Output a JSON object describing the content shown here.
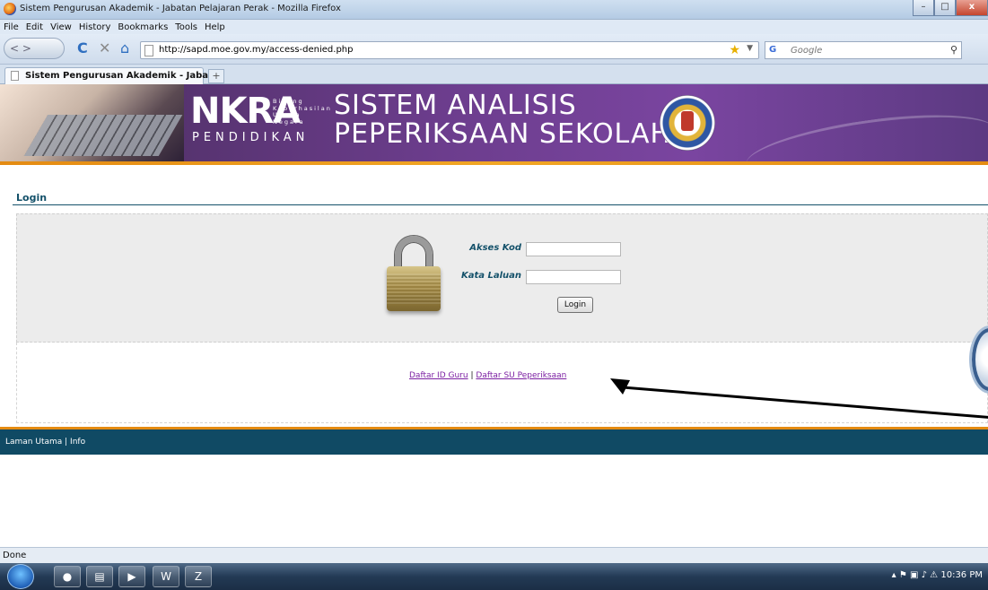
{
  "window": {
    "title": "Sistem Pengurusan Akademik - Jabatan Pelajaran Perak - Mozilla Firefox",
    "controls": {
      "minimize": "–",
      "maximize": "□",
      "close": "x"
    }
  },
  "menu": [
    "File",
    "Edit",
    "View",
    "History",
    "Bookmarks",
    "Tools",
    "Help"
  ],
  "nav": {
    "back_forward": "<  >",
    "reload": "C",
    "stop": "✕",
    "home": "⌂",
    "url": "http://sapd.moe.gov.my/access-denied.php",
    "search_engine": "G",
    "search_placeholder": "Google"
  },
  "tabs": [
    {
      "label": "Sistem Pengurusan Akademik - Jabat..."
    }
  ],
  "new_tab": "+",
  "banner": {
    "nkra": "NKRA",
    "nkra_sub": [
      "Bidang",
      "Keberhasilan",
      "Utama",
      "Negara"
    ],
    "pendidikan": "PENDIDIKAN",
    "line1": "SISTEM ANALISIS",
    "line2": "PEPERIKSAAN SEKOLAH"
  },
  "login": {
    "heading": "Login",
    "access_code_label": "Akses Kod",
    "access_code_value": "",
    "password_label": "Kata Laluan",
    "password_value": "",
    "button": "Login"
  },
  "links": {
    "register_teacher": "Daftar ID Guru",
    "separator": "|",
    "register_exam_sec": "Daftar SU Peperiksaan"
  },
  "footer": {
    "text": "Laman Utama | Info"
  },
  "status": {
    "text": "Done"
  },
  "taskbar": {
    "time": "10:36 PM"
  },
  "colors": {
    "accent": "#14516a",
    "footer": "#104a64",
    "orange": "#e48b12",
    "banner": "#6c3d8d",
    "link": "#7b1fa2"
  },
  "icons": [
    "firefox-icon",
    "lock-icon",
    "emblem-icon",
    "star-icon",
    "search-icon",
    "windows-start-icon"
  ]
}
